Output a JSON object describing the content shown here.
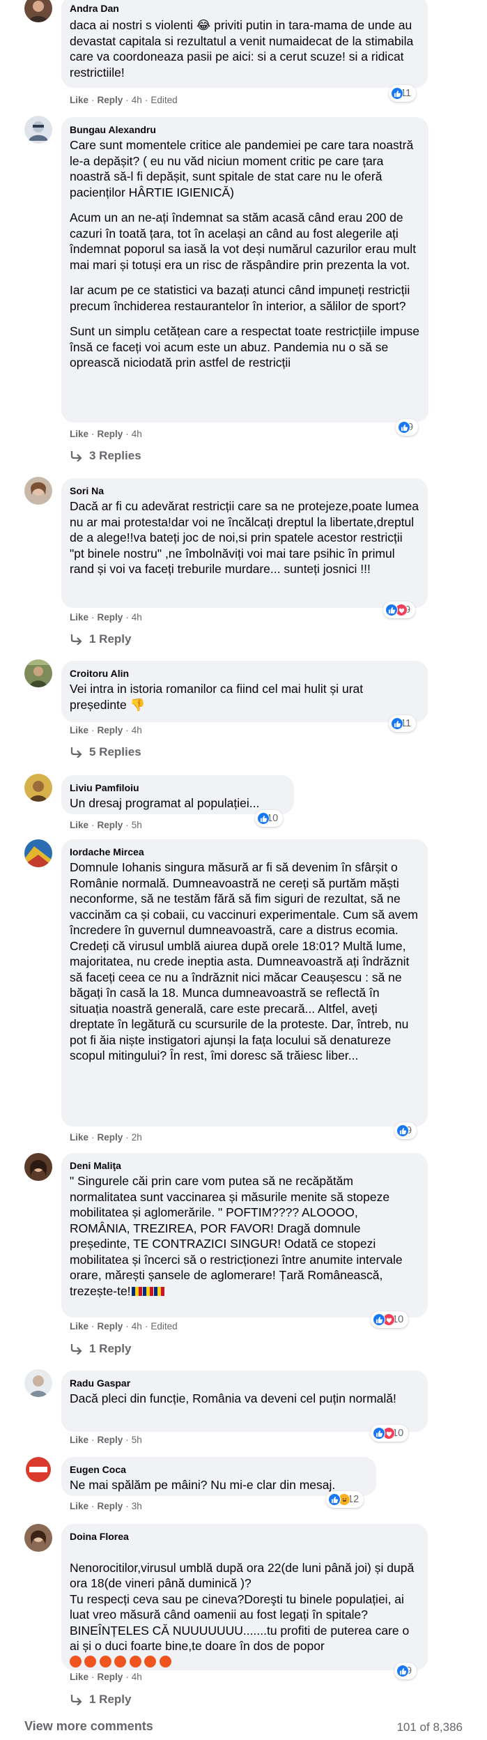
{
  "actions": {
    "like": "Like",
    "reply": "Reply",
    "edited": "Edited"
  },
  "comments": [
    {
      "author": "Andra Dan",
      "text": [
        "daca ai nostri s violenti 😂 priviti putin in tara-mama de unde au devastat capitala si rezultatul a venit numaidecat de la stimabila care va coordoneaza pasii pe aici: si a cerut scuze! si a ridicat restrictiile!"
      ],
      "time": "4h",
      "edited": true,
      "reactions": {
        "types": [
          "like"
        ],
        "count": "11"
      }
    },
    {
      "author": "Bungau Alexandru",
      "text": [
        "Care sunt momentele critice ale pandemiei pe care tara noastră le-a depășit? ( eu nu văd niciun moment critic pe care țara noastră să-l fi depășit, sunt spitale de stat care nu le oferă pacienților HÂRTIE IGIENICĂ)",
        "Acum un an ne-ați îndemnat sa stăm acasă când erau 200 de cazuri în toată țara, tot în același an când au fost alegerile ați îndemnat poporul sa iasă la vot deși numărul cazurilor erau mult mai mari și totuși era un risc de răspândire prin prezenta la vot.",
        "Iar acum pe ce statistici va bazați atunci când impuneți restricții precum închiderea restaurantelor în interior, a sălilor de sport?",
        "Sunt un simplu cetățean care a respectat toate restricțiile impuse însă ce faceți voi acum este un abuz. Pandemia nu o să se oprească niciodată prin astfel de restricții"
      ],
      "time": "4h",
      "edited": false,
      "reactions": {
        "types": [
          "like"
        ],
        "count": "9"
      },
      "replies": "3 Replies"
    },
    {
      "author": "Sori Na",
      "text": [
        "Dacă ar fi cu adevărat restricții care sa ne protejeze,poate lumea nu ar mai protesta!dar voi ne încălcați dreptul la libertate,dreptul de a alege!!va bateți joc de noi,si prin spatele acestor restricții \"pt binele nostru\" ,ne îmbolnăviți voi mai tare psihic în primul rand și voi va faceți treburile murdare... sunteți josnici !!!"
      ],
      "time": "4h",
      "edited": false,
      "reactions": {
        "types": [
          "like",
          "love"
        ],
        "count": "9"
      },
      "replies": "1 Reply"
    },
    {
      "author": "Croitoru Alin",
      "text": [
        "Vei intra in istoria romanilor ca fiind cel mai hulit și urat președinte 👎"
      ],
      "time": "4h",
      "edited": false,
      "reactions": {
        "types": [
          "like"
        ],
        "count": "11"
      },
      "replies": "5 Replies"
    },
    {
      "author": "Liviu Pamfiloiu",
      "text": [
        "Un dresaj programat al populației..."
      ],
      "time": "5h",
      "edited": false,
      "reactions": {
        "types": [
          "like"
        ],
        "count": "10"
      }
    },
    {
      "author": "Iordache Mircea",
      "text": [
        "Domnule Iohanis singura măsură ar fi să devenim în sfârșit o Românie normală. Dumneavoastră ne cereți să purtăm măști neconforme, să ne testăm fără să fim siguri de rezultat, să ne vaccinăm ca și cobaii, cu vaccinuri experimentale. Cum să avem încredere în guvernul dumneavoastră, care a distrus ecomia. Credeți că virusul umblă aiurea după orele 18:01? Multă lume, majoritatea, nu crede ineptia asta. Dumneavoastră ați îndrăznit să faceți ceea ce nu a îndrăznit nici măcar Ceaușescu : să ne băgați în casă la 18. Munca dumneavoastră se reflectă în situația noastră generală, care este precară... Altfel, aveți dreptate în legătură cu scursurile de la proteste. Dar, întreb, nu pot fi ăia niște instigatori ajunși la fața locului să denatureze scopul mitingului? În rest, îmi doresc să trăiesc liber..."
      ],
      "time": "2h",
      "edited": false,
      "reactions": {
        "types": [
          "like"
        ],
        "count": "9"
      }
    },
    {
      "author": "Deni Maliţa",
      "text": [
        "\" Singurele căi prin care vom putea să ne recăpătăm normalitatea sunt vaccinarea și măsurile menite să stopeze mobilitatea și aglomerările. \" POFTIM???? ALOOOO, ROMÂNIA, TREZIREA, POR FAVOR! Dragă domnule președinte, TE CONTRAZICI SINGUR! Odată ce stopezi mobilitatea și încerci să o restricționezi între anumite intervale orare, mărești șansele de aglomerare! Țară Românească, trezește-te!"
      ],
      "time": "4h",
      "edited": true,
      "reactions": {
        "types": [
          "like",
          "love"
        ],
        "count": "10"
      },
      "replies": "1 Reply"
    },
    {
      "author": "Radu Gaspar",
      "text": [
        "Dacă pleci din funcție, România va deveni cel puțin normală!"
      ],
      "time": "5h",
      "edited": false,
      "reactions": {
        "types": [
          "like",
          "love"
        ],
        "count": "10"
      }
    },
    {
      "author": "Eugen Coca",
      "text": [
        "Ne mai spălăm pe mâini? Nu mi-e clar din mesaj."
      ],
      "time": "3h",
      "edited": false,
      "reactions": {
        "types": [
          "like",
          "haha"
        ],
        "count": "12"
      }
    },
    {
      "author": "Doina Florea",
      "text": [
        "Nenorocitilor,virusul umblă după ora 22(de luni până joi) și după ora 18(de vineri până duminică )?\nTu respecți ceva sau pe cineva?Doreşti tu binele populației, ai luat vreo măsură când oamenii au fost legați în spitale?BINEÎNȚELES CĂ NUUUUUUU.......tu profiti de puterea care o ai și o duci foarte bine,te doare în dos de popor"
      ],
      "time": "4h",
      "edited": false,
      "reactions": {
        "types": [
          "like"
        ],
        "count": "9"
      },
      "replies": "1 Reply"
    }
  ],
  "footer": {
    "view_more": "View more comments",
    "count": "101 of 8,386"
  },
  "colors": {
    "bubble": "#f0f2f5",
    "secondary_text": "#65676b",
    "like_blue": "#1877f2",
    "love_red": "#f33e58",
    "haha_yellow": "#f7b125"
  }
}
